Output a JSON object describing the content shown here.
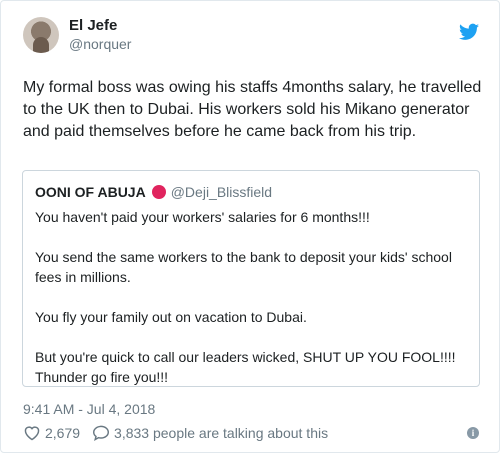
{
  "author": {
    "display_name": "El Jefe",
    "handle": "@norquer"
  },
  "tweet": {
    "text": "My formal boss was owing his staffs 4months salary, he travelled to the UK then to Dubai. His workers sold his Mikano generator and paid themselves before he came back from his trip."
  },
  "quoted": {
    "display_name": "OONI OF ABUJA",
    "handle": "@Deji_Blissfield",
    "paragraphs": [
      "You haven't paid your workers' salaries for 6 months!!!",
      "You send the same workers to the bank to deposit your kids' school fees in millions.",
      "You fly your family out on vacation to Dubai.",
      "But you're quick to call our leaders wicked, SHUT UP YOU FOOL!!!! Thunder go fire you!!!"
    ]
  },
  "meta": {
    "timestamp": "9:41 AM - Jul 4, 2018",
    "likes": "2,679",
    "talking": "3,833 people are talking about this"
  },
  "colors": {
    "twitter_blue": "#1da1f2",
    "badge_red": "#e0245e",
    "muted": "#697882"
  }
}
